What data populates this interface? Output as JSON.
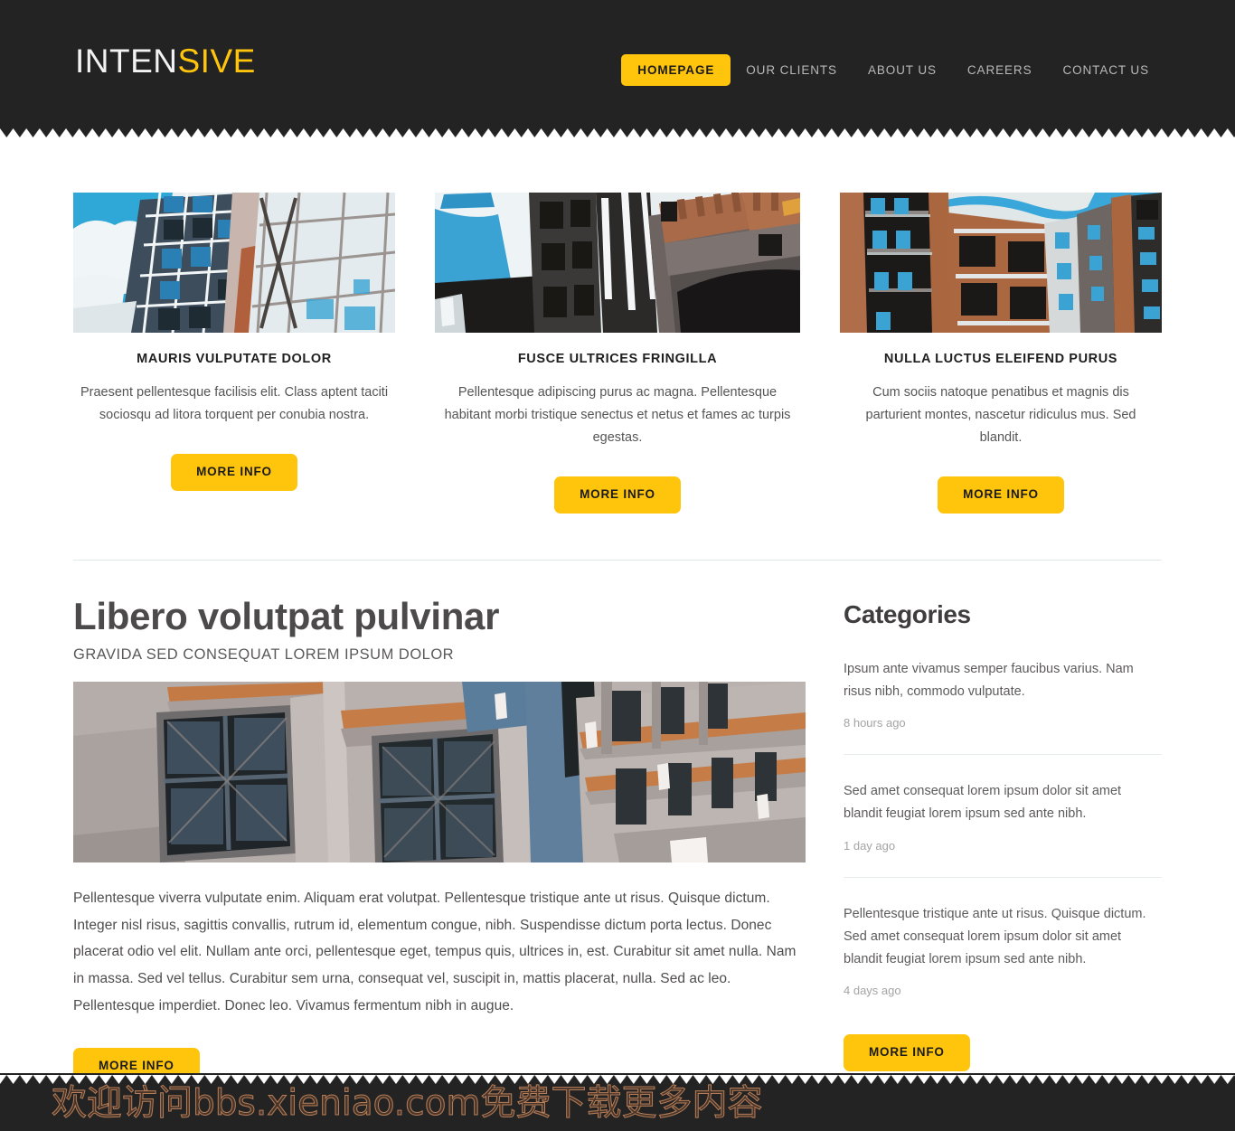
{
  "header": {
    "logo_primary": "INTEN",
    "logo_accent": "SIVE",
    "nav": [
      {
        "label": "HOMEPAGE",
        "active": true
      },
      {
        "label": "OUR CLIENTS",
        "active": false
      },
      {
        "label": "ABOUT US",
        "active": false
      },
      {
        "label": "CAREERS",
        "active": false
      },
      {
        "label": "CONTACT US",
        "active": false
      }
    ]
  },
  "features": [
    {
      "image_alt": "glass-office-tower-photo",
      "title": "MAURIS VULPUTATE DOLOR",
      "text": "Praesent pellentesque facilisis elit. Class aptent taciti sociosqu ad litora torquent per conubia nostra.",
      "cta": "MORE INFO"
    },
    {
      "image_alt": "city-street-buildings-photo",
      "title": "FUSCE ULTRICES FRINGILLA",
      "text": "Pellentesque adipiscing purus ac magna. Pellentesque habitant morbi tristique senectus et netus et fames ac turpis egestas.",
      "cta": "MORE INFO"
    },
    {
      "image_alt": "brick-apartment-block-photo",
      "title": "NULLA LUCTUS ELEIFEND PURUS",
      "text": "Cum sociis natoque penatibus et magnis dis parturient montes, nascetur ridiculus mus. Sed blandit.",
      "cta": "MORE INFO"
    }
  ],
  "article": {
    "title": "Libero volutpat pulvinar",
    "subtitle": "GRAVIDA SED CONSEQUAT LOREM IPSUM DOLOR",
    "image_alt": "building-facade-windows-photo",
    "body": "Pellentesque viverra vulputate enim. Aliquam erat volutpat. Pellentesque tristique ante ut risus. Quisque dictum. Integer nisl risus, sagittis convallis, rutrum id, elementum congue, nibh. Suspendisse dictum porta lectus. Donec placerat odio vel elit. Nullam ante orci, pellentesque eget, tempus quis, ultrices in, est. Curabitur sit amet nulla. Nam in massa. Sed vel tellus. Curabitur sem urna, consequat vel, suscipit in, mattis placerat, nulla. Sed ac leo. Pellentesque imperdiet. Donec leo. Vivamus fermentum nibh in augue.",
    "cta": "MORE INFO"
  },
  "sidebar": {
    "title": "Categories",
    "items": [
      {
        "text": "Ipsum ante vivamus semper faucibus varius. Nam risus nibh, commodo vulputate.",
        "time": "8 hours ago"
      },
      {
        "text": "Sed amet consequat lorem ipsum dolor sit amet blandit feugiat lorem ipsum sed ante nibh.",
        "time": "1 day ago"
      },
      {
        "text": "Pellentesque tristique ante ut risus. Quisque dictum. Sed amet consequat lorem ipsum dolor sit amet blandit feugiat lorem ipsum sed ante nibh.",
        "time": "4 days ago"
      }
    ],
    "cta": "MORE INFO"
  },
  "footer": {
    "watermark": "欢迎访问bbs.xieniao.com免费下载更多内容"
  },
  "colors": {
    "accent": "#ffc40c",
    "dark": "#232323",
    "body_text": "#4f4d4d",
    "muted_text": "#a5a3a3",
    "rule": "#e2e8e8"
  }
}
